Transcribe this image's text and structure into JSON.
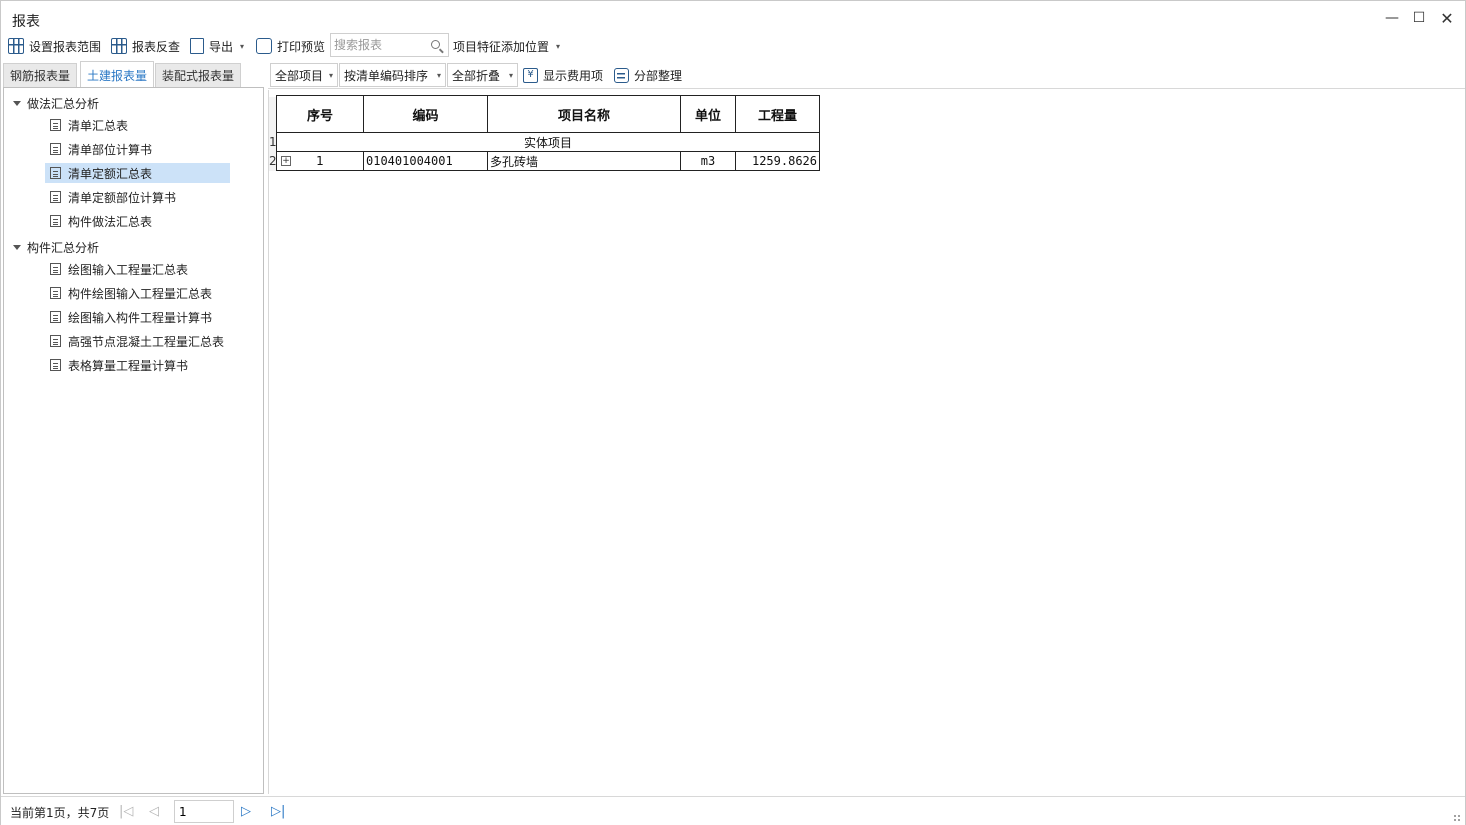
{
  "window": {
    "title": "报表",
    "min_glyph": "—",
    "max_glyph": "☐",
    "close_glyph": "✕"
  },
  "toolbar": {
    "set_range_label": "设置报表范围",
    "reverse_check_label": "报表反查",
    "export_label": "导出",
    "print_preview_label": "打印预览",
    "search_placeholder": "搜索报表",
    "feature_position_label": "项目特征添加位置",
    "caret": "▾"
  },
  "left_tabs": [
    {
      "label": "钢筋报表量"
    },
    {
      "label": "土建报表量"
    },
    {
      "label": "装配式报表量"
    }
  ],
  "tree": {
    "groups": [
      {
        "label": "做法汇总分析",
        "items": [
          {
            "label": "清单汇总表"
          },
          {
            "label": "清单部位计算书"
          },
          {
            "label": "清单定额汇总表"
          },
          {
            "label": "清单定额部位计算书"
          },
          {
            "label": "构件做法汇总表"
          }
        ]
      },
      {
        "label": "构件汇总分析",
        "items": [
          {
            "label": "绘图输入工程量汇总表"
          },
          {
            "label": "构件绘图输入工程量汇总表"
          },
          {
            "label": "绘图输入构件工程量计算书"
          },
          {
            "label": "高强节点混凝土工程量汇总表"
          },
          {
            "label": "表格算量工程量计算书"
          }
        ]
      }
    ]
  },
  "filters": {
    "all_items": "全部项目",
    "sort_by_code": "按清单编码排序",
    "collapse_all": "全部折叠",
    "show_fees": "显示费用项",
    "section_organize": "分部整理",
    "yen_glyph": "¥"
  },
  "table": {
    "headers": {
      "seq": "序号",
      "code": "编码",
      "name": "项目名称",
      "unit": "单位",
      "qty": "工程量"
    },
    "group_row": {
      "row_num": "1",
      "label": "实体项目"
    },
    "rows": [
      {
        "row_num": "2",
        "seq": "1",
        "code": "010401004001",
        "name": "多孔砖墙",
        "unit": "m3",
        "qty": "1259.8626"
      }
    ],
    "expand_glyph": "+"
  },
  "status": {
    "page_info": "当前第1页，共7页",
    "current_page": "1",
    "first_glyph": "|◁",
    "prev_glyph": "◁",
    "next_glyph": "▷",
    "last_glyph": "▷|"
  },
  "colors": {
    "accent": "#2b78c5",
    "selected_row": "#cce2f8",
    "icon_blue": "#2b5b8c"
  }
}
